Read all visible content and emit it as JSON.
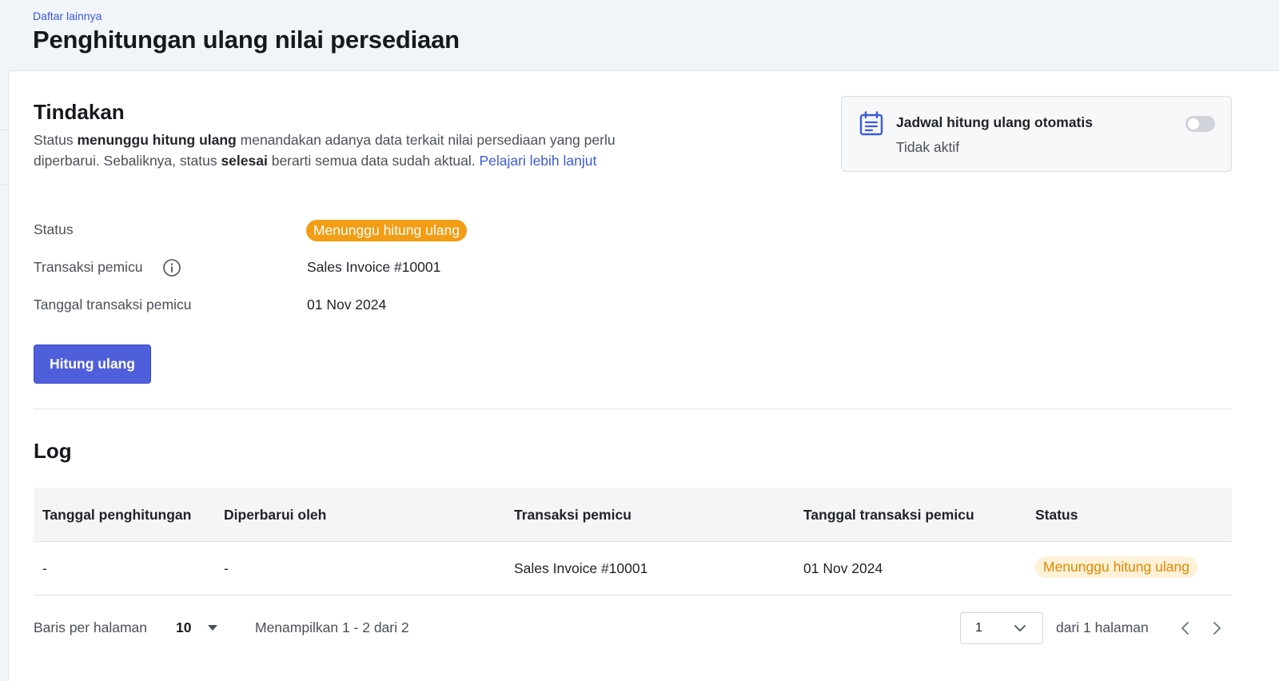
{
  "header": {
    "breadcrumb": "Daftar lainnya",
    "title": "Penghitungan ulang nilai persediaan"
  },
  "action": {
    "title": "Tindakan",
    "desc_1": "Status ",
    "desc_bold_1": "menunggu hitung ulang",
    "desc_2": " menandakan adanya data terkait nilai persediaan yang perlu diperbarui. Sebaliknya, status ",
    "desc_bold_2": "selesai",
    "desc_3": " berarti semua data sudah aktual. ",
    "desc_link": "Pelajari lebih lanjut",
    "status_label": "Status",
    "status_value": "Menunggu hitung ulang",
    "trigger_label": "Transaksi pemicu",
    "trigger_value": "Sales Invoice #10001",
    "trigger_date_label": "Tanggal transaksi pemicu",
    "trigger_date_value": "01 Nov 2024",
    "button_label": "Hitung ulang"
  },
  "schedule": {
    "title": "Jadwal hitung ulang otomatis",
    "status": "Tidak aktif",
    "enabled": false
  },
  "log": {
    "title": "Log",
    "columns": [
      "Tanggal penghitungan",
      "Diperbarui oleh",
      "Transaksi pemicu",
      "Tanggal transaksi pemicu",
      "Status"
    ],
    "rows": [
      {
        "date": "-",
        "updated_by": "-",
        "trigger": "Sales Invoice #10001",
        "trigger_date": "01 Nov 2024",
        "status": "Menunggu hitung ulang"
      }
    ]
  },
  "pagination": {
    "rows_label": "Baris per halaman",
    "rows_value": "10",
    "showing": "Menampilkan 1 - 2 dari 2",
    "page_value": "1",
    "of_pages": "dari 1 halaman"
  },
  "colors": {
    "accent": "#4f5fdc",
    "link": "#3b5bdb",
    "warning": "#f29d14",
    "warning_soft_bg": "#fdf1d8"
  }
}
